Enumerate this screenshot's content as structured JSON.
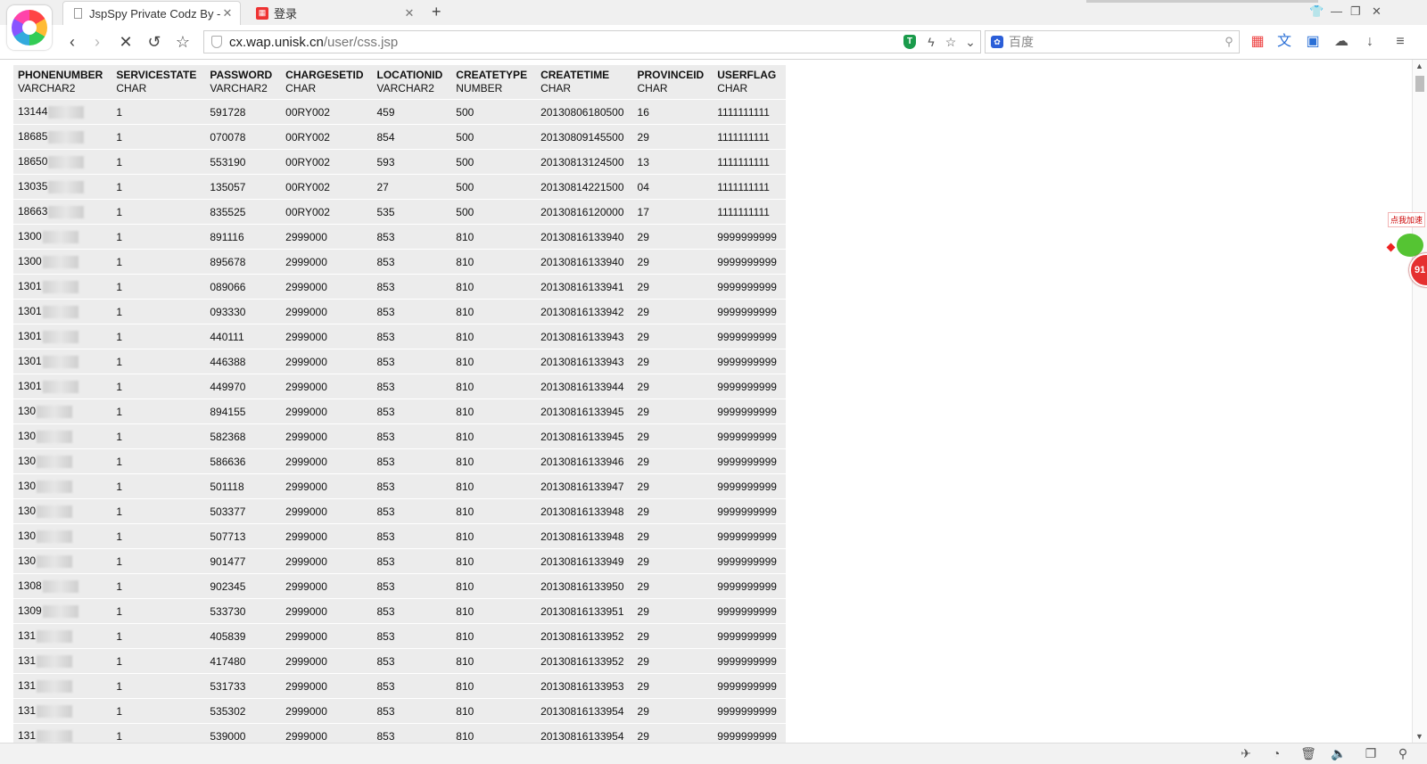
{
  "tabs": [
    {
      "title": "JspSpy Private Codz By - I",
      "icon": "document-icon",
      "active": true
    },
    {
      "title": "登录",
      "icon": "grid-logo-icon",
      "active": false
    }
  ],
  "address": {
    "domain": "cx.wap.unisk.cn",
    "path": "/user/css.jsp"
  },
  "search": {
    "placeholder": "百度",
    "engine": "baidu-paw-icon"
  },
  "widget": {
    "label": "点我加速",
    "badge": "91"
  },
  "table": {
    "headers": [
      {
        "name": "PHONENUMBER",
        "type": "VARCHAR2"
      },
      {
        "name": "SERVICESTATE",
        "type": "CHAR"
      },
      {
        "name": "PASSWORD",
        "type": "VARCHAR2"
      },
      {
        "name": "CHARGESETID",
        "type": "CHAR"
      },
      {
        "name": "LOCATIONID",
        "type": "VARCHAR2"
      },
      {
        "name": "CREATETYPE",
        "type": "NUMBER"
      },
      {
        "name": "CREATETIME",
        "type": "CHAR"
      },
      {
        "name": "PROVINCEID",
        "type": "CHAR"
      },
      {
        "name": "USERFLAG",
        "type": "CHAR"
      }
    ],
    "rows": [
      [
        "13144",
        "1",
        "591728",
        "00RY002",
        "459",
        "500",
        "20130806180500",
        "16",
        "1111111111"
      ],
      [
        "18685",
        "1",
        "070078",
        "00RY002",
        "854",
        "500",
        "20130809145500",
        "29",
        "1111111111"
      ],
      [
        "18650",
        "1",
        "553190",
        "00RY002",
        "593",
        "500",
        "20130813124500",
        "13",
        "1111111111"
      ],
      [
        "13035",
        "1",
        "135057",
        "00RY002",
        "27",
        "500",
        "20130814221500",
        "04",
        "1111111111"
      ],
      [
        "18663",
        "1",
        "835525",
        "00RY002",
        "535",
        "500",
        "20130816120000",
        "17",
        "1111111111"
      ],
      [
        "1300",
        "1",
        "891116",
        "2999000",
        "853",
        "810",
        "20130816133940",
        "29",
        "9999999999"
      ],
      [
        "1300",
        "1",
        "895678",
        "2999000",
        "853",
        "810",
        "20130816133940",
        "29",
        "9999999999"
      ],
      [
        "1301",
        "1",
        "089066",
        "2999000",
        "853",
        "810",
        "20130816133941",
        "29",
        "9999999999"
      ],
      [
        "1301",
        "1",
        "093330",
        "2999000",
        "853",
        "810",
        "20130816133942",
        "29",
        "9999999999"
      ],
      [
        "1301",
        "1",
        "440111",
        "2999000",
        "853",
        "810",
        "20130816133943",
        "29",
        "9999999999"
      ],
      [
        "1301",
        "1",
        "446388",
        "2999000",
        "853",
        "810",
        "20130816133943",
        "29",
        "9999999999"
      ],
      [
        "1301",
        "1",
        "449970",
        "2999000",
        "853",
        "810",
        "20130816133944",
        "29",
        "9999999999"
      ],
      [
        "130",
        "1",
        "894155",
        "2999000",
        "853",
        "810",
        "20130816133945",
        "29",
        "9999999999"
      ],
      [
        "130",
        "1",
        "582368",
        "2999000",
        "853",
        "810",
        "20130816133945",
        "29",
        "9999999999"
      ],
      [
        "130",
        "1",
        "586636",
        "2999000",
        "853",
        "810",
        "20130816133946",
        "29",
        "9999999999"
      ],
      [
        "130",
        "1",
        "501118",
        "2999000",
        "853",
        "810",
        "20130816133947",
        "29",
        "9999999999"
      ],
      [
        "130",
        "1",
        "503377",
        "2999000",
        "853",
        "810",
        "20130816133948",
        "29",
        "9999999999"
      ],
      [
        "130",
        "1",
        "507713",
        "2999000",
        "853",
        "810",
        "20130816133948",
        "29",
        "9999999999"
      ],
      [
        "130",
        "1",
        "901477",
        "2999000",
        "853",
        "810",
        "20130816133949",
        "29",
        "9999999999"
      ],
      [
        "1308",
        "1",
        "902345",
        "2999000",
        "853",
        "810",
        "20130816133950",
        "29",
        "9999999999"
      ],
      [
        "1309",
        "1",
        "533730",
        "2999000",
        "853",
        "810",
        "20130816133951",
        "29",
        "9999999999"
      ],
      [
        "131",
        "1",
        "405839",
        "2999000",
        "853",
        "810",
        "20130816133952",
        "29",
        "9999999999"
      ],
      [
        "131",
        "1",
        "417480",
        "2999000",
        "853",
        "810",
        "20130816133952",
        "29",
        "9999999999"
      ],
      [
        "131",
        "1",
        "531733",
        "2999000",
        "853",
        "810",
        "20130816133953",
        "29",
        "9999999999"
      ],
      [
        "131",
        "1",
        "535302",
        "2999000",
        "853",
        "810",
        "20130816133954",
        "29",
        "9999999999"
      ],
      [
        "131",
        "1",
        "539000",
        "2999000",
        "853",
        "810",
        "20130816133954",
        "29",
        "9999999999"
      ]
    ]
  }
}
